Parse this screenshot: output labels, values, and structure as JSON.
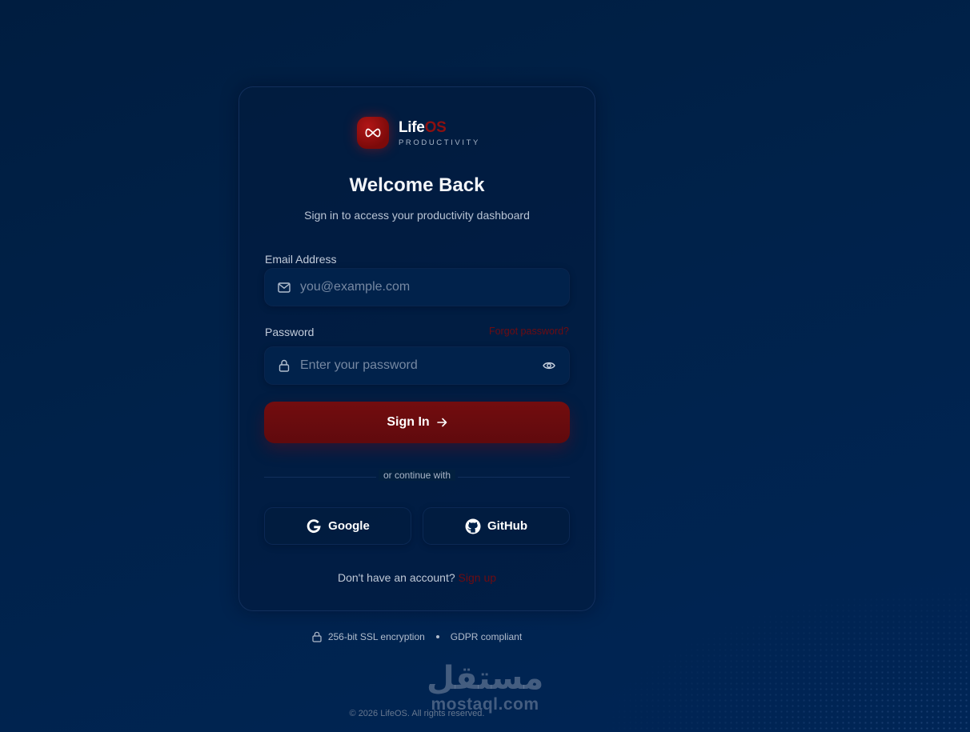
{
  "brand": {
    "name_part1": "Life",
    "name_part2": "OS",
    "tagline": "PRODUCTIVITY",
    "logo_icon": "infinity-icon",
    "accent_color": "#8c1010"
  },
  "card": {
    "title": "Welcome Back",
    "subtitle": "Sign in to access your productivity dashboard"
  },
  "form": {
    "email": {
      "label": "Email Address",
      "placeholder": "you@example.com",
      "value": "",
      "icon": "mail-icon"
    },
    "password": {
      "label": "Password",
      "placeholder": "Enter your password",
      "value": "",
      "icon": "lock-icon",
      "toggle_icon": "eye-icon"
    },
    "forgot_link": "Forgot password?",
    "submit_label": "Sign In",
    "submit_icon": "arrow-right-icon",
    "submit_color": "#6a0b0e"
  },
  "social": {
    "divider_text": "or continue with",
    "google_label": "Google",
    "github_label": "GitHub"
  },
  "signup": {
    "prompt": "Don't have an account?",
    "link": "Sign up"
  },
  "security": {
    "ssl": "256-bit SSL encryption",
    "gdpr": "GDPR compliant"
  },
  "footer": {
    "copyright": "© 2026 LifeOS. All rights reserved."
  },
  "watermark": {
    "arabic": "مستقل",
    "latin": "mostaql.com"
  }
}
